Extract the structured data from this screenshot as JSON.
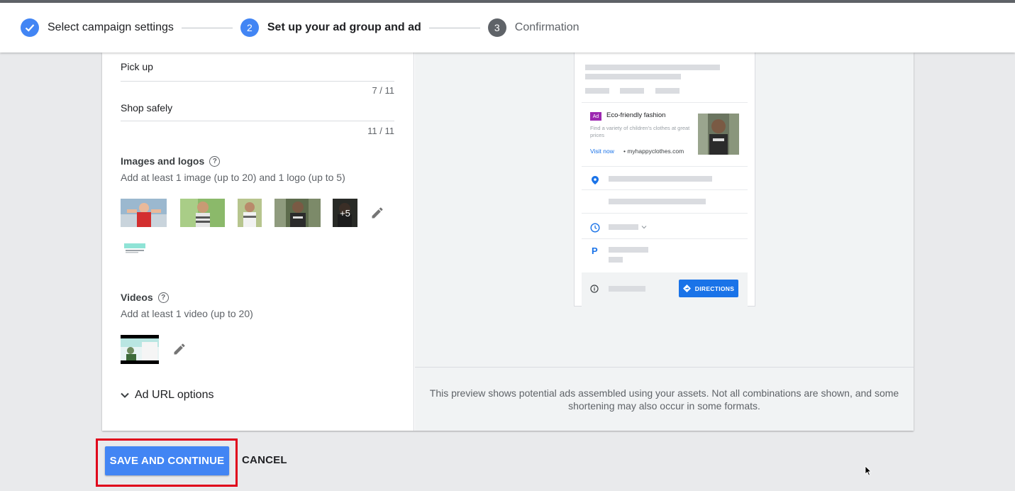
{
  "stepper": {
    "steps": [
      {
        "label": "Select campaign settings",
        "state": "done"
      },
      {
        "number": "2",
        "label": "Set up your ad group and ad",
        "state": "active"
      },
      {
        "number": "3",
        "label": "Confirmation",
        "state": "todo"
      }
    ]
  },
  "form": {
    "headlines": [
      {
        "value": "Pick up",
        "counter": "7 / 11"
      },
      {
        "value": "Shop safely",
        "counter": "11 / 11"
      }
    ],
    "images": {
      "title": "Images and logos",
      "subtitle": "Add at least 1 image (up to 20) and 1 logo (up to 5)",
      "more_count": "+5"
    },
    "videos": {
      "title": "Videos",
      "subtitle": "Add at least 1 video (up to 20)"
    },
    "url_options_label": "Ad URL options"
  },
  "preview": {
    "ad_badge": "Ad",
    "ad_title": "Eco-friendly fashion",
    "ad_description": "Find a variety of children's clothes at great prices",
    "visit_label": "Visit now",
    "domain": "myhappyclothes.com",
    "directions_label": "DIRECTIONS",
    "note": "This preview shows potential ads assembled using your assets. Not all combinations are shown, and some shortening may also occur in some formats."
  },
  "actions": {
    "save_label": "SAVE AND CONTINUE",
    "cancel_label": "CANCEL"
  },
  "colors": {
    "accent": "#4285f4",
    "highlight_frame": "#e0001b",
    "ad_badge": "#9c27b0"
  }
}
